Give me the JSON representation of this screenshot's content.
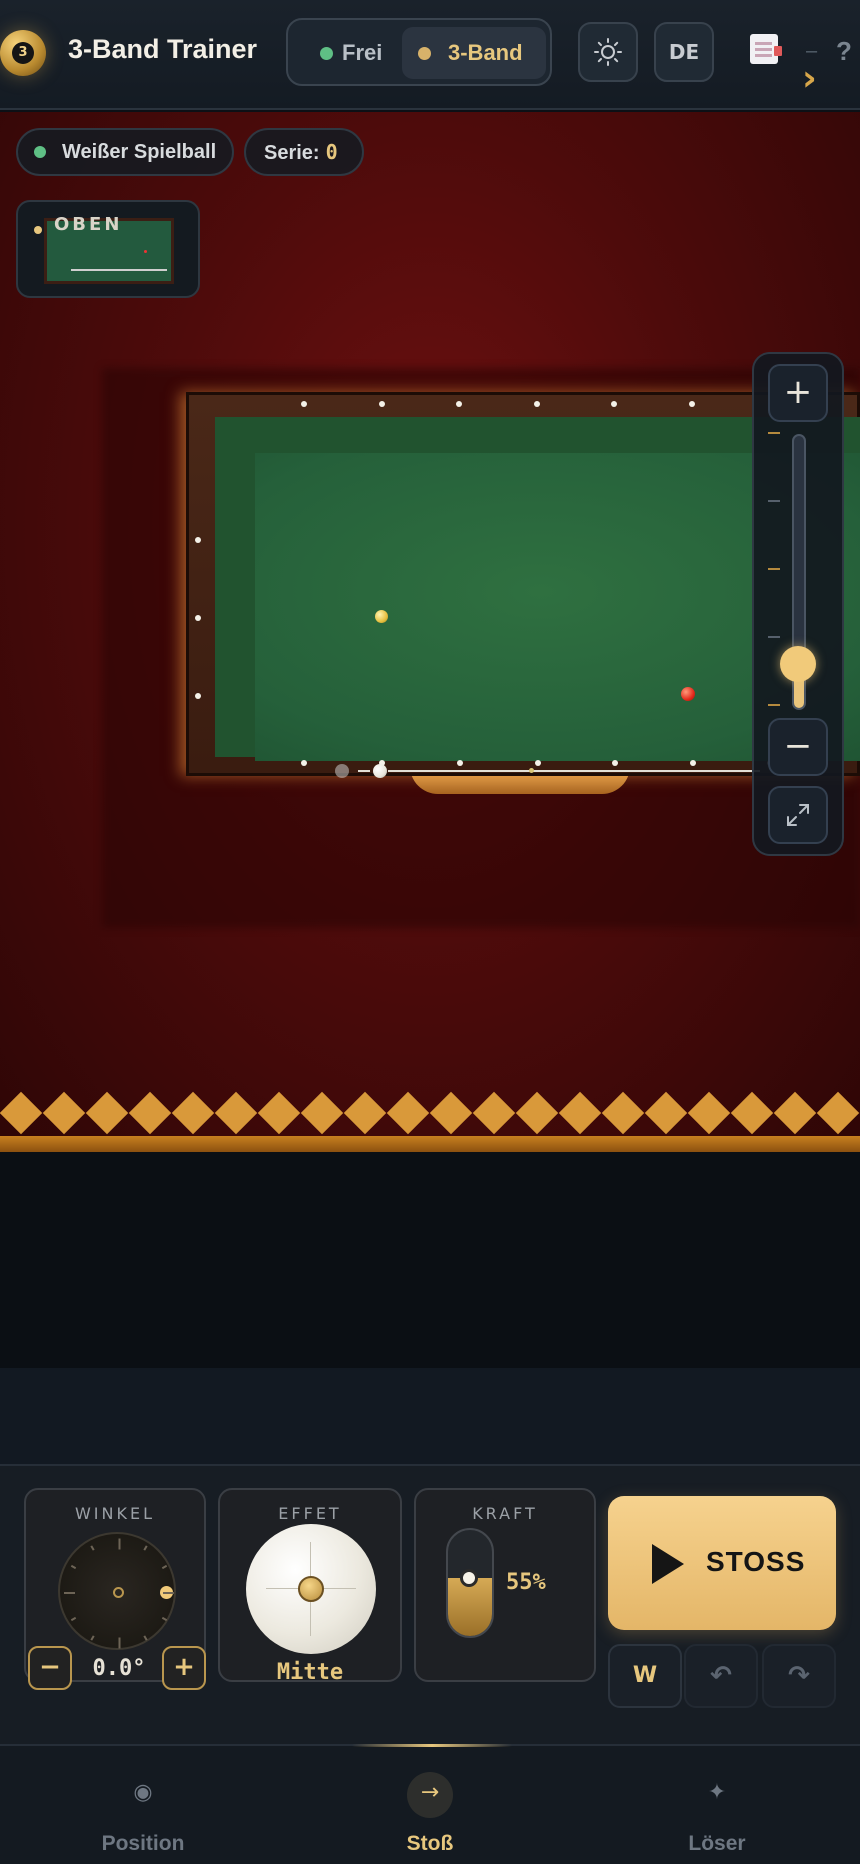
{
  "header": {
    "logo_number": "3",
    "title": "3-Band Trainer",
    "modes": [
      {
        "label": "Frei",
        "active": false,
        "color": "#5fbf85"
      },
      {
        "label": "3-Band",
        "active": true,
        "color": "#d7b26a"
      }
    ],
    "theme_icon": "sun-icon",
    "language": "DE",
    "notes_icon": "document-icon",
    "dash": "–",
    "help": "?",
    "more_icon": "chevron-right-icon"
  },
  "scene": {
    "ball_selector": "Weißer Spielball",
    "series_label": "Serie:",
    "series_value": "0",
    "minimap_label": "OBEN",
    "zoom": {
      "plus": "+",
      "minus": "−",
      "fit_icon": "expand-icon",
      "level": 0.16
    },
    "colors": {
      "felt": "#2f7040",
      "cushion": "#21532f",
      "rail": "#4a2818",
      "carpet": "#6e1010",
      "accent": "#e7c77e"
    }
  },
  "controls": {
    "angle": {
      "label": "WINKEL",
      "value": "0.0°",
      "minus": "−",
      "plus": "+"
    },
    "effect": {
      "label": "EFFET",
      "value": "Mitte"
    },
    "power": {
      "label": "KRAFT",
      "value": "55%",
      "level": 0.55
    },
    "shoot_label": "STOSS",
    "w_label": "W",
    "undo_icon": "undo-icon",
    "redo_icon": "redo-icon"
  },
  "nav": {
    "items": [
      {
        "label": "Position",
        "icon": "◉",
        "active": false
      },
      {
        "label": "Stoß",
        "icon": "→",
        "active": true
      },
      {
        "label": "Löser",
        "icon": "✦",
        "active": false
      }
    ]
  }
}
